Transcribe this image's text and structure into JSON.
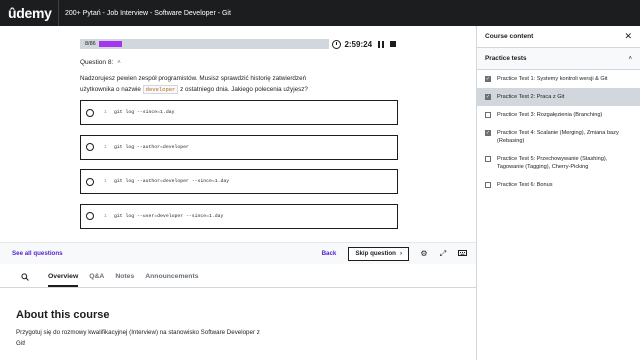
{
  "topbar": {
    "logo": "ûdemy",
    "course_title": "200+ Pytań - Job Interview - Software Developer - Git"
  },
  "quiz": {
    "progress_count": "8/86",
    "progress_fraction": 0.093,
    "timer": "2:59:24",
    "question_label": "Question 8:",
    "question_text_part1": "Nadzorujesz pewien zespół programistów. Musisz sprawdzić historię zatwierdzeń użytkownika o nazwie",
    "question_code": "developer",
    "question_text_part2": "z ostatniego dnia. Jakiego polecenia użyjesz?",
    "answers": [
      {
        "line": "1",
        "code": "git log --since=1.day"
      },
      {
        "line": "1",
        "code": "git log --author=developer"
      },
      {
        "line": "1",
        "code": "git log --author=developer --since=1.day"
      },
      {
        "line": "1",
        "code": "git log --user=developer --since=1.day"
      }
    ]
  },
  "actionbar": {
    "see_all": "See all questions",
    "back": "Back",
    "skip": "Skip question",
    "skip_arrow": "›"
  },
  "tabs": {
    "search_icon": "search-icon",
    "items": [
      "Overview",
      "Q&A",
      "Notes",
      "Announcements"
    ]
  },
  "about": {
    "title": "About this course",
    "text": "Przygotuj się do rozmowy kwalifikacyjnej (Interview) na stanowisko Software Developer z Git!"
  },
  "sidebar": {
    "title": "Course content",
    "close": "✕",
    "section_title": "Practice tests",
    "section_chevron": "˄",
    "items": [
      {
        "label": "Practice Test 1: Systemy kontroli wersji & Git",
        "checked": true
      },
      {
        "label": "Practice Test 2: Praca z Git",
        "checked": true
      },
      {
        "label": "Practice Test 3: Rozgałęzienia (Branching)",
        "checked": false
      },
      {
        "label": "Practice Test 4: Scalanie (Merging), Zmiana bazy (Rebasing)",
        "checked": true
      },
      {
        "label": "Practice Test 5: Przechowywanie (Stashing), Tagowanie (Tagging), Cherry-Picking",
        "checked": false
      },
      {
        "label": "Practice Test 6: Bonus",
        "checked": false
      }
    ]
  },
  "colors": {
    "accent": "#a435f0",
    "link": "#5624d0",
    "topbar": "#1c1d1f"
  }
}
